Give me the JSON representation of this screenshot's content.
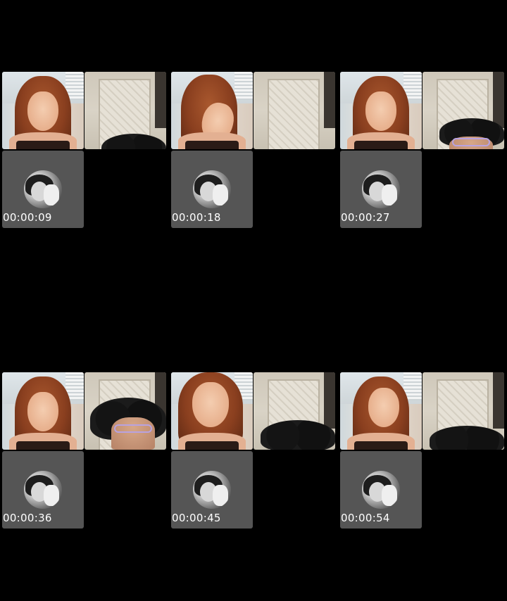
{
  "frames": [
    {
      "timestamp": "00:00:09"
    },
    {
      "timestamp": "00:00:18"
    },
    {
      "timestamp": "00:00:27"
    },
    {
      "timestamp": "00:00:36"
    },
    {
      "timestamp": "00:00:45"
    },
    {
      "timestamp": "00:00:54"
    }
  ],
  "colors": {
    "background": "#000000",
    "avatar_tile": "#555555",
    "timestamp_text": "#ffffff"
  }
}
